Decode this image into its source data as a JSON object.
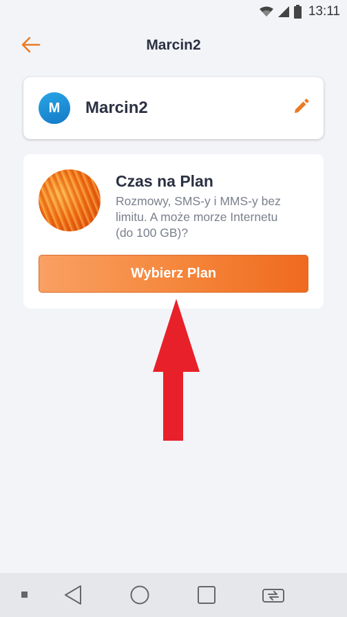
{
  "status_bar": {
    "time": "13:11",
    "icons": [
      "wifi-icon",
      "signal-icon",
      "battery-icon"
    ]
  },
  "header": {
    "title": "Marcin2",
    "back_icon": "arrow-left-icon"
  },
  "profile": {
    "avatar_letter": "M",
    "name": "Marcin2",
    "edit_icon": "pencil-icon"
  },
  "plan_card": {
    "title": "Czas na Plan",
    "description": "Rozmowy, SMS-y i MMS-y bez limitu. A może morze Internetu (do 100 GB)?",
    "button_label": "Wybierz Plan"
  },
  "nav_bar": {
    "icons": [
      "square-dot-icon",
      "back-triangle-icon",
      "home-circle-icon",
      "recents-square-icon",
      "switch-sim-icon"
    ]
  },
  "colors": {
    "accent": "#f07d2c",
    "title": "#2b3142",
    "avatar": "#1e8fd6",
    "background": "#f3f4f8",
    "annotation_arrow": "#e8202a"
  }
}
